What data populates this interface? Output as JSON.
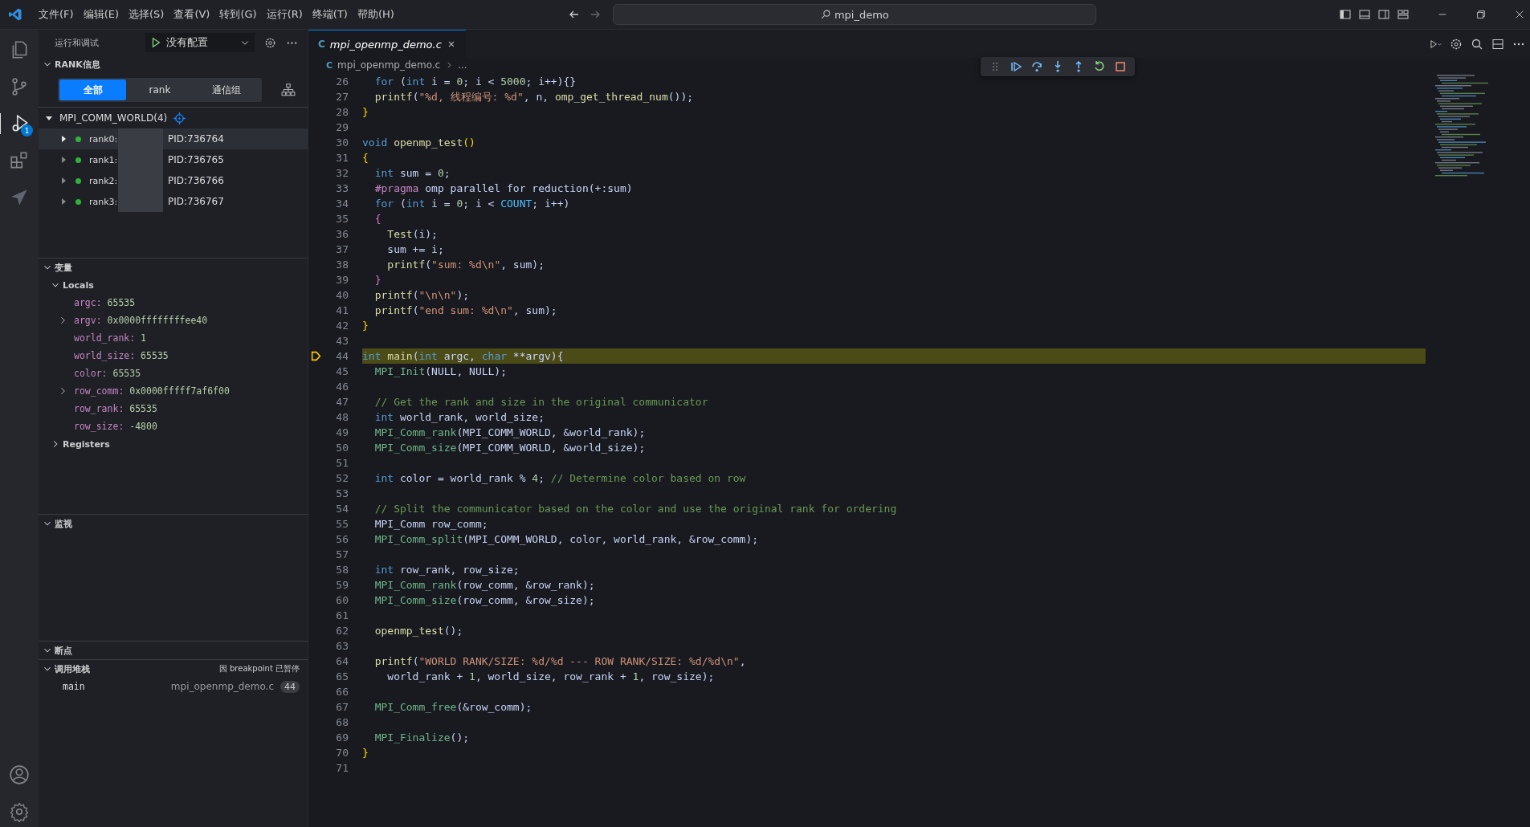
{
  "menu": [
    "文件(F)",
    "编辑(E)",
    "选择(S)",
    "查看(V)",
    "转到(G)",
    "运行(R)",
    "终端(T)",
    "帮助(H)"
  ],
  "search": {
    "value": "mpi_demo"
  },
  "activity": {
    "debug_badge": "1"
  },
  "sidebar": {
    "title": "运行和调试",
    "config": "没有配置",
    "rank_section": {
      "title": "RANK信息",
      "expanded": true,
      "tabs": [
        {
          "label": "全部",
          "selected": true
        },
        {
          "label": "rank",
          "selected": false
        },
        {
          "label": "通信组",
          "selected": false
        }
      ],
      "group": {
        "label": "MPI_COMM_WORLD(4)",
        "expanded": true
      },
      "ranks": [
        {
          "label": "rank0:",
          "pid": "PID:736764",
          "expanded": false,
          "selected": true
        },
        {
          "label": "rank1:",
          "pid": "PID:736765",
          "expanded": false,
          "selected": false
        },
        {
          "label": "rank2:",
          "pid": "PID:736766",
          "expanded": false,
          "selected": false
        },
        {
          "label": "rank3:",
          "pid": "PID:736767",
          "expanded": false,
          "selected": false
        }
      ]
    },
    "variables": {
      "title": "变量",
      "expanded": true,
      "scopes": [
        {
          "label": "Locals",
          "expanded": true,
          "vars": [
            {
              "name": "argc:",
              "value": "65535",
              "expandable": false
            },
            {
              "name": "argv:",
              "value": "0x0000ffffffffee40",
              "expandable": true
            },
            {
              "name": "world_rank:",
              "value": "1",
              "expandable": false
            },
            {
              "name": "world_size:",
              "value": "65535",
              "expandable": false
            },
            {
              "name": "color:",
              "value": "65535",
              "expandable": false
            },
            {
              "name": "row_comm:",
              "value": "0x0000fffff7af6f00",
              "expandable": true
            },
            {
              "name": "row_rank:",
              "value": "65535",
              "expandable": false
            },
            {
              "name": "row_size:",
              "value": "-4800",
              "expandable": false
            }
          ]
        },
        {
          "label": "Registers",
          "expanded": false
        }
      ]
    },
    "watch": {
      "title": "监视",
      "expanded": true
    },
    "breakpoints": {
      "title": "断点",
      "expanded": true
    },
    "call_stack": {
      "title": "调用堆栈",
      "expanded": true,
      "status": "因 breakpoint 已暂停",
      "frames": [
        {
          "name": "main",
          "file": "mpi_openmp_demo.c",
          "line": "44"
        }
      ]
    }
  },
  "editor": {
    "tab": {
      "icon_text": "C",
      "label": "mpi_openmp_demo.c"
    },
    "breadcrumb": {
      "icon_text": "C",
      "file": "mpi_openmp_demo.c",
      "rest": "..."
    },
    "lines": [
      {
        "number": "26",
        "current": false,
        "segments": [
          {
            "kind": "kw",
            "text": "  for"
          },
          {
            "kind": "pl",
            "text": " ("
          },
          {
            "kind": "kw",
            "text": "int"
          },
          {
            "kind": "pl",
            "text": " i = "
          },
          {
            "kind": "num",
            "text": "0"
          },
          {
            "kind": "pl",
            "text": "; i < "
          },
          {
            "kind": "num",
            "text": "5000"
          },
          {
            "kind": "pl",
            "text": "; i++){}"
          }
        ]
      },
      {
        "number": "27",
        "current": false,
        "segments": [
          {
            "kind": "fn",
            "text": "  printf"
          },
          {
            "kind": "pl",
            "text": "("
          },
          {
            "kind": "str",
            "text": "\"%d, 线程编号: %d\""
          },
          {
            "kind": "pl",
            "text": ", n, "
          },
          {
            "kind": "fn",
            "text": "omp_get_thread_num"
          },
          {
            "kind": "pl",
            "text": "());"
          }
        ]
      },
      {
        "number": "28",
        "current": false,
        "segments": [
          {
            "kind": "br",
            "text": "}"
          }
        ]
      },
      {
        "number": "29",
        "current": false
      },
      {
        "number": "30",
        "current": false,
        "segments": [
          {
            "kind": "kw",
            "text": "void"
          },
          {
            "kind": "fn",
            "text": " openmp_test"
          },
          {
            "kind": "br",
            "text": "()"
          }
        ]
      },
      {
        "number": "31",
        "current": false,
        "segments": [
          {
            "kind": "br",
            "text": "{"
          }
        ]
      },
      {
        "number": "32",
        "current": false,
        "segments": [
          {
            "kind": "kw",
            "text": "  int"
          },
          {
            "kind": "pl",
            "text": " sum = "
          },
          {
            "kind": "num",
            "text": "0"
          },
          {
            "kind": "pl",
            "text": ";"
          }
        ]
      },
      {
        "number": "33",
        "current": false,
        "segments": [
          {
            "kind": "pp",
            "text": "  #pragma"
          },
          {
            "kind": "pl",
            "text": " omp parallel for reduction(+:sum)"
          }
        ]
      },
      {
        "number": "34",
        "current": false,
        "segments": [
          {
            "kind": "kw",
            "text": "  for"
          },
          {
            "kind": "pl",
            "text": " ("
          },
          {
            "kind": "kw",
            "text": "int"
          },
          {
            "kind": "pl",
            "text": " i = "
          },
          {
            "kind": "num",
            "text": "0"
          },
          {
            "kind": "pl",
            "text": "; i < "
          },
          {
            "kind": "mac",
            "text": "COUNT"
          },
          {
            "kind": "pl",
            "text": "; i++)"
          }
        ]
      },
      {
        "number": "35",
        "current": false,
        "segments": [
          {
            "kind": "pa",
            "text": "  {"
          }
        ]
      },
      {
        "number": "36",
        "current": false,
        "segments": [
          {
            "kind": "fn",
            "text": "    Test"
          },
          {
            "kind": "pl",
            "text": "(i);"
          }
        ]
      },
      {
        "number": "37",
        "current": false,
        "segments": [
          {
            "kind": "pl",
            "text": "    sum += i;"
          }
        ]
      },
      {
        "number": "38",
        "current": false,
        "segments": [
          {
            "kind": "fn",
            "text": "    printf"
          },
          {
            "kind": "pl",
            "text": "("
          },
          {
            "kind": "str",
            "text": "\"sum: %d\\n\""
          },
          {
            "kind": "pl",
            "text": ", sum);"
          }
        ]
      },
      {
        "number": "39",
        "current": false,
        "segments": [
          {
            "kind": "pa",
            "text": "  }"
          }
        ]
      },
      {
        "number": "40",
        "current": false,
        "segments": [
          {
            "kind": "fn",
            "text": "  printf"
          },
          {
            "kind": "pl",
            "text": "("
          },
          {
            "kind": "str",
            "text": "\"\\n\\n\""
          },
          {
            "kind": "pl",
            "text": ");"
          }
        ]
      },
      {
        "number": "41",
        "current": false,
        "segments": [
          {
            "kind": "fn",
            "text": "  printf"
          },
          {
            "kind": "pl",
            "text": "("
          },
          {
            "kind": "str",
            "text": "\"end sum: %d\\n\""
          },
          {
            "kind": "pl",
            "text": ", sum);"
          }
        ]
      },
      {
        "number": "42",
        "current": false,
        "segments": [
          {
            "kind": "br",
            "text": "}"
          }
        ]
      },
      {
        "number": "43",
        "current": false
      },
      {
        "number": "44",
        "current": true,
        "segments": [
          {
            "kind": "kw",
            "text": "int"
          },
          {
            "kind": "fn",
            "text": " main"
          },
          {
            "kind": "pl",
            "text": "("
          },
          {
            "kind": "kw",
            "text": "int"
          },
          {
            "kind": "pl",
            "text": " argc, "
          },
          {
            "kind": "kw",
            "text": "char"
          },
          {
            "kind": "pl",
            "text": " **argv){"
          }
        ]
      },
      {
        "number": "45",
        "current": false,
        "segments": [
          {
            "kind": "mpi",
            "text": "  MPI_Init"
          },
          {
            "kind": "pl",
            "text": "(NULL, NULL);"
          }
        ]
      },
      {
        "number": "46",
        "current": false
      },
      {
        "number": "47",
        "current": false,
        "segments": [
          {
            "kind": "cm",
            "text": "  // Get the rank and size in the original communicator"
          }
        ]
      },
      {
        "number": "48",
        "current": false,
        "segments": [
          {
            "kind": "kw",
            "text": "  int"
          },
          {
            "kind": "pl",
            "text": " world_rank, world_size;"
          }
        ]
      },
      {
        "number": "49",
        "current": false,
        "segments": [
          {
            "kind": "mpi",
            "text": "  MPI_Comm_rank"
          },
          {
            "kind": "pl",
            "text": "(MPI_COMM_WORLD, &world_rank);"
          }
        ]
      },
      {
        "number": "50",
        "current": false,
        "segments": [
          {
            "kind": "mpi",
            "text": "  MPI_Comm_size"
          },
          {
            "kind": "pl",
            "text": "(MPI_COMM_WORLD, &world_size);"
          }
        ]
      },
      {
        "number": "51",
        "current": false
      },
      {
        "number": "52",
        "current": false,
        "segments": [
          {
            "kind": "kw",
            "text": "  int"
          },
          {
            "kind": "pl",
            "text": " color = world_rank % "
          },
          {
            "kind": "num",
            "text": "4"
          },
          {
            "kind": "pl",
            "text": ";"
          },
          {
            "kind": "cm",
            "text": " // Determine color based on row"
          }
        ]
      },
      {
        "number": "53",
        "current": false
      },
      {
        "number": "54",
        "current": false,
        "segments": [
          {
            "kind": "cm",
            "text": "  // Split the communicator based on the color and use the original rank for ordering"
          }
        ]
      },
      {
        "number": "55",
        "current": false,
        "segments": [
          {
            "kind": "pl",
            "text": "  MPI_Comm row_comm;"
          }
        ]
      },
      {
        "number": "56",
        "current": false,
        "segments": [
          {
            "kind": "mpi",
            "text": "  MPI_Comm_split"
          },
          {
            "kind": "pl",
            "text": "(MPI_COMM_WORLD, color, world_rank, &row_comm);"
          }
        ]
      },
      {
        "number": "57",
        "current": false
      },
      {
        "number": "58",
        "current": false,
        "segments": [
          {
            "kind": "kw",
            "text": "  int"
          },
          {
            "kind": "pl",
            "text": " row_rank, row_size;"
          }
        ]
      },
      {
        "number": "59",
        "current": false,
        "segments": [
          {
            "kind": "mpi",
            "text": "  MPI_Comm_rank"
          },
          {
            "kind": "pl",
            "text": "(row_comm, &row_rank);"
          }
        ]
      },
      {
        "number": "60",
        "current": false,
        "segments": [
          {
            "kind": "mpi",
            "text": "  MPI_Comm_size"
          },
          {
            "kind": "pl",
            "text": "(row_comm, &row_size);"
          }
        ]
      },
      {
        "number": "61",
        "current": false
      },
      {
        "number": "62",
        "current": false,
        "segments": [
          {
            "kind": "fn",
            "text": "  openmp_test"
          },
          {
            "kind": "pl",
            "text": "();"
          }
        ]
      },
      {
        "number": "63",
        "current": false
      },
      {
        "number": "64",
        "current": false,
        "segments": [
          {
            "kind": "fn",
            "text": "  printf"
          },
          {
            "kind": "pl",
            "text": "("
          },
          {
            "kind": "str",
            "text": "\"WORLD RANK/SIZE: %d/%d --- ROW RANK/SIZE: %d/%d\\n\""
          },
          {
            "kind": "pl",
            "text": ","
          }
        ]
      },
      {
        "number": "65",
        "current": false,
        "segments": [
          {
            "kind": "pl",
            "text": "    world_rank + "
          },
          {
            "kind": "num",
            "text": "1"
          },
          {
            "kind": "pl",
            "text": ", world_size, row_rank + "
          },
          {
            "kind": "num",
            "text": "1"
          },
          {
            "kind": "pl",
            "text": ", row_size);"
          }
        ]
      },
      {
        "number": "66",
        "current": false
      },
      {
        "number": "67",
        "current": false,
        "segments": [
          {
            "kind": "mpi",
            "text": "  MPI_Comm_free"
          },
          {
            "kind": "pl",
            "text": "(&row_comm);"
          }
        ]
      },
      {
        "number": "68",
        "current": false
      },
      {
        "number": "69",
        "current": false,
        "segments": [
          {
            "kind": "mpi",
            "text": "  MPI_Finalize"
          },
          {
            "kind": "pl",
            "text": "();"
          }
        ]
      },
      {
        "number": "70",
        "current": false,
        "segments": [
          {
            "kind": "br",
            "text": "}"
          }
        ]
      },
      {
        "number": "71",
        "current": false
      }
    ]
  }
}
